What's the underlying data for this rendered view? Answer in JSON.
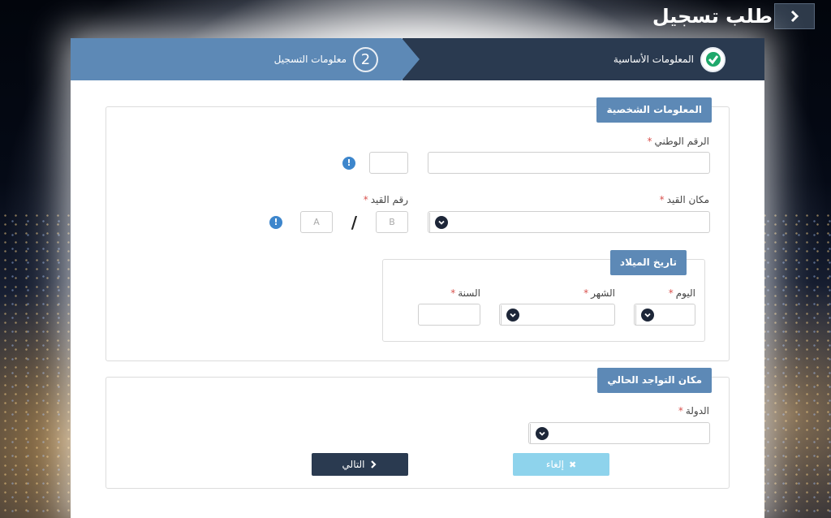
{
  "header": {
    "title": "طلب تسجيل"
  },
  "stepper": {
    "step1_label": "المعلومات الأساسية",
    "step2_label": "معلومات التسجيل",
    "step2_number": "2"
  },
  "personal": {
    "legend": "المعلومات الشخصية",
    "national_id_label": "الرقم الوطني",
    "registry_place_label": "مكان القيد",
    "registry_number_label": "رقم القيد",
    "registry_a_placeholder": "A",
    "registry_b_placeholder": "B",
    "separator": "/",
    "required_mark": "*",
    "info_mark": "!"
  },
  "birth": {
    "legend": "تاريخ الميلاد",
    "day_label": "اليوم",
    "month_label": "الشهر",
    "year_label": "السنة"
  },
  "location": {
    "legend": "مكان التواجد الحالي",
    "country_label": "الدولة"
  },
  "buttons": {
    "next_label": "التالي",
    "cancel_label": "إلغاء"
  },
  "colors": {
    "accent": "#5d89b6",
    "dark": "#2a3a50",
    "cancel": "#8ed3ec",
    "required": "#d9534f",
    "info": "#3d86cc"
  }
}
